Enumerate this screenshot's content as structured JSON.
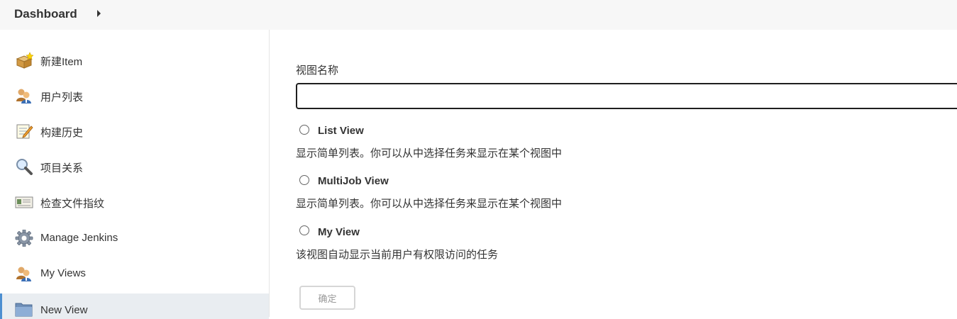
{
  "header": {
    "breadcrumb": "Dashboard"
  },
  "sidebar": {
    "items": [
      {
        "label": "新建Item",
        "icon": "new-item-icon"
      },
      {
        "label": "用户列表",
        "icon": "users-icon"
      },
      {
        "label": "构建历史",
        "icon": "notepad-icon"
      },
      {
        "label": "项目关系",
        "icon": "magnifier-icon"
      },
      {
        "label": "检查文件指纹",
        "icon": "fingerprint-card-icon"
      },
      {
        "label": "Manage Jenkins",
        "icon": "gear-icon"
      },
      {
        "label": "My Views",
        "icon": "users-icon"
      },
      {
        "label": "New View",
        "icon": "folder-icon"
      }
    ],
    "active_item": "New View"
  },
  "form": {
    "name_label": "视图名称",
    "name_value": "",
    "options": [
      {
        "title": "List View",
        "description": "显示简单列表。你可以从中选择任务来显示在某个视图中"
      },
      {
        "title": "MultiJob View",
        "description": "显示简单列表。你可以从中选择任务来显示在某个视图中"
      },
      {
        "title": "My View",
        "description": "该视图自动显示当前用户有权限访问的任务"
      }
    ],
    "submit_label": "确定"
  }
}
